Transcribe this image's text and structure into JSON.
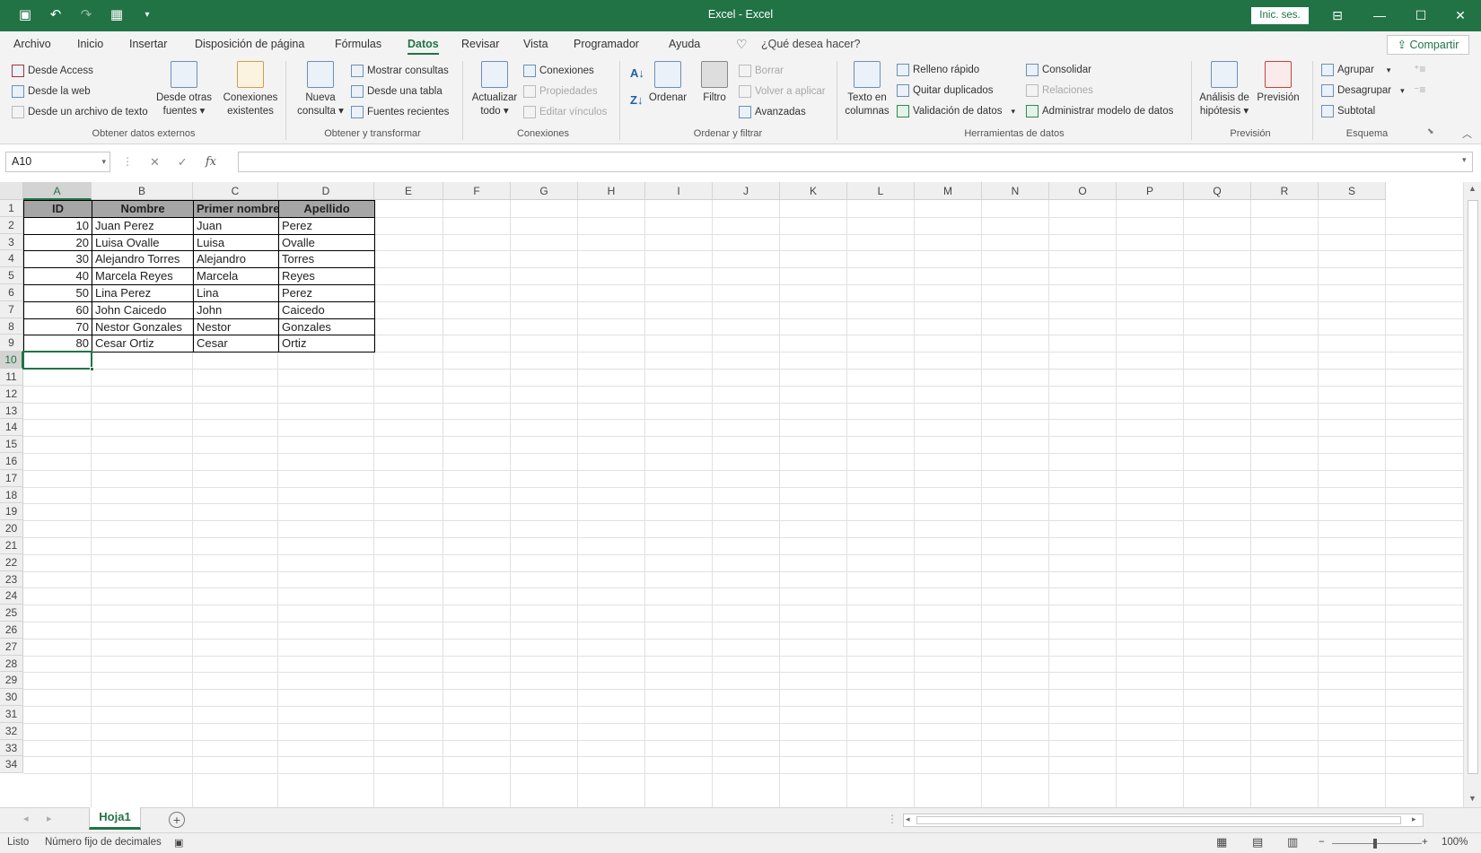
{
  "window": {
    "title": "Excel - Excel",
    "signin_label": "Inic. ses.",
    "share_label": "Compartir"
  },
  "menu": {
    "tabs": [
      "Archivo",
      "Inicio",
      "Insertar",
      "Disposición de página",
      "Fórmulas",
      "Datos",
      "Revisar",
      "Vista",
      "Programador",
      "Ayuda"
    ],
    "active_tab": "Datos",
    "tellme": "¿Qué desea hacer?"
  },
  "ribbon": {
    "groups": {
      "external": "Obtener datos externos",
      "transform": "Obtener y transformar",
      "connections": "Conexiones",
      "sortfilter": "Ordenar y filtrar",
      "datatools": "Herramientas de datos",
      "forecast": "Previsión",
      "outline": "Esquema"
    },
    "btn": {
      "from_access": "Desde Access",
      "from_web": "Desde la web",
      "from_text": "Desde un archivo de texto",
      "other_sources_1": "Desde otras",
      "other_sources_2": "fuentes ▾",
      "existing_1": "Conexiones",
      "existing_2": "existentes",
      "new_query_1": "Nueva",
      "new_query_2": "consulta ▾",
      "show_queries": "Mostrar consultas",
      "from_table": "Desde una tabla",
      "recent_sources": "Fuentes recientes",
      "refresh_1": "Actualizar",
      "refresh_2": "todo ▾",
      "connections": "Conexiones",
      "properties": "Propiedades",
      "edit_links": "Editar vínculos",
      "sort": "Ordenar",
      "filter": "Filtro",
      "clear": "Borrar",
      "reapply": "Volver a aplicar",
      "advanced": "Avanzadas",
      "text_columns_1": "Texto en",
      "text_columns_2": "columnas",
      "flash_fill": "Relleno rápido",
      "remove_dup": "Quitar duplicados",
      "validation": "Validación de datos",
      "consolidate": "Consolidar",
      "relations": "Relaciones",
      "data_model": "Administrar modelo de datos",
      "whatif_1": "Análisis de",
      "whatif_2": "hipótesis ▾",
      "forecast": "Previsión",
      "group": "Agrupar",
      "ungroup": "Desagrupar",
      "subtotal": "Subtotal"
    }
  },
  "formula_bar": {
    "name_box": "A10",
    "fx": "fx",
    "value": ""
  },
  "columns": [
    "A",
    "B",
    "C",
    "D",
    "E",
    "F",
    "G",
    "H",
    "I",
    "J",
    "K",
    "L",
    "M",
    "N",
    "O",
    "P",
    "Q",
    "R",
    "S"
  ],
  "rows": [
    "1",
    "2",
    "3",
    "4",
    "5",
    "6",
    "7",
    "8",
    "9",
    "10",
    "11",
    "12",
    "13",
    "14",
    "15",
    "16",
    "17",
    "18",
    "19",
    "20",
    "21",
    "22",
    "23",
    "24",
    "25",
    "26",
    "27",
    "28",
    "29",
    "30",
    "31",
    "32",
    "33",
    "34"
  ],
  "table": {
    "headers": [
      "ID",
      "Nombre",
      "Primer nombre",
      "Apellido"
    ],
    "rows": [
      [
        "10",
        "Juan Perez",
        "Juan",
        "Perez"
      ],
      [
        "20",
        "Luisa Ovalle",
        "Luisa",
        "Ovalle"
      ],
      [
        "30",
        "Alejandro Torres",
        "Alejandro",
        "Torres"
      ],
      [
        "40",
        "Marcela Reyes",
        "Marcela",
        "Reyes"
      ],
      [
        "50",
        "Lina Perez",
        "Lina",
        "Perez"
      ],
      [
        "60",
        "John Caicedo",
        "John",
        "Caicedo"
      ],
      [
        "70",
        "Nestor Gonzales",
        "Nestor",
        "Gonzales"
      ],
      [
        "80",
        "Cesar Ortiz",
        "Cesar",
        "Ortiz"
      ]
    ]
  },
  "active_cell": "A10",
  "sheets": [
    "Hoja1"
  ],
  "status": {
    "ready": "Listo",
    "fixed_decimal": "Número fijo de decimales",
    "zoom": "100%"
  },
  "colors": {
    "accent": "#217346",
    "header_fill": "#a6a6a6"
  }
}
